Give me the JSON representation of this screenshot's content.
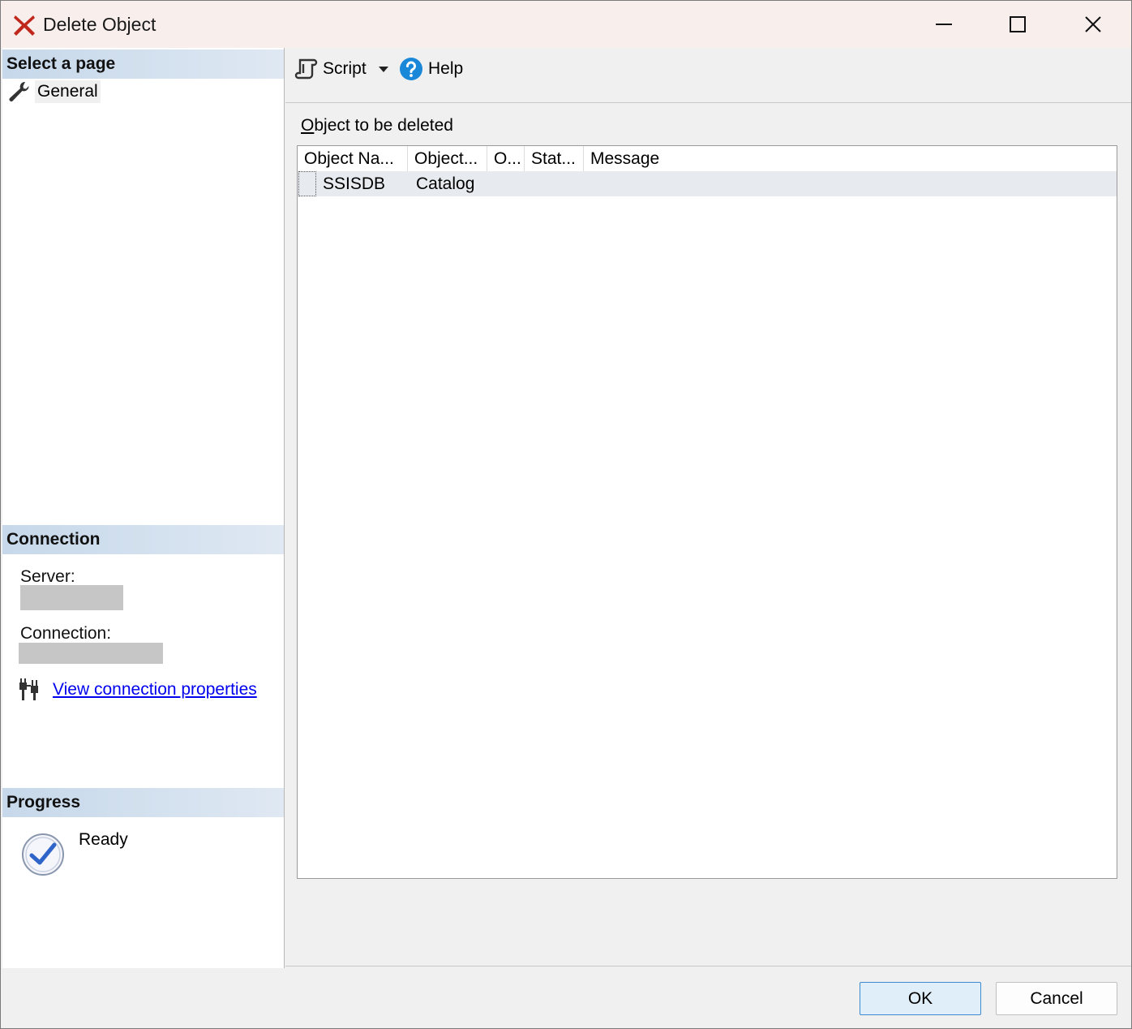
{
  "window": {
    "title": "Delete Object",
    "controls": {
      "minimize": "minimize-icon",
      "maximize": "maximize-icon",
      "close": "close-icon"
    }
  },
  "left": {
    "select_page_header": "Select a page",
    "pages": [
      {
        "label": "General",
        "icon": "wrench-icon"
      }
    ],
    "connection_header": "Connection",
    "server_label": "Server:",
    "connection_label": "Connection:",
    "view_connection_link": "View connection properties",
    "progress_header": "Progress",
    "progress_status": "Ready"
  },
  "toolbar": {
    "script_label": "Script",
    "help_label": "Help"
  },
  "main": {
    "object_label_accel": "O",
    "object_label_rest": "bject to be deleted",
    "columns": [
      "Object Na...",
      "Object...",
      "O...",
      "Stat...",
      "Message"
    ],
    "rows": [
      {
        "name": "SSISDB",
        "type": "Catalog",
        "owner": "",
        "status": "",
        "message": ""
      }
    ]
  },
  "buttons": {
    "ok": "OK",
    "cancel": "Cancel"
  },
  "colors": {
    "title_bar": "#f8efed",
    "section_header": "#c6d8ea",
    "link": "#0000ee",
    "ok_border": "#3c8ad0",
    "close_x": "#c0281c"
  }
}
